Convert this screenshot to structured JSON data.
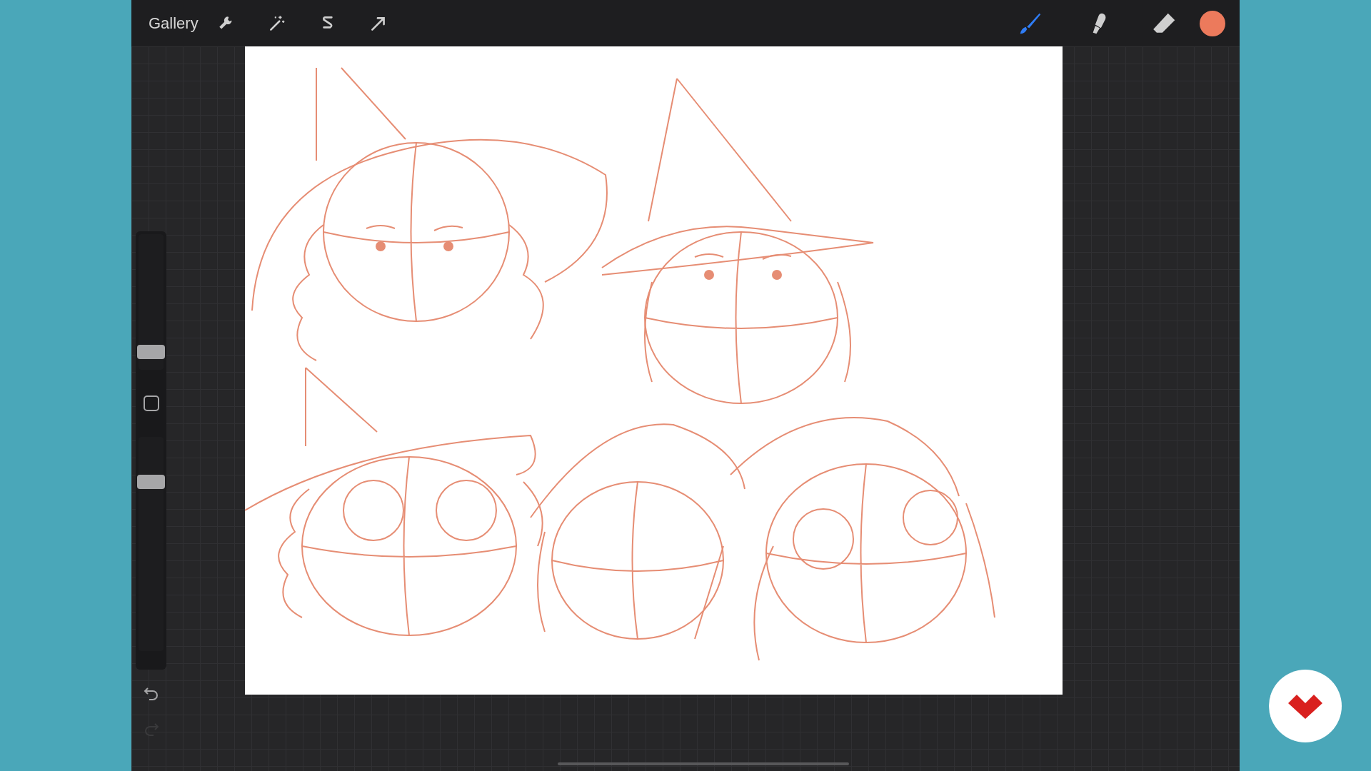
{
  "toolbar": {
    "gallery": "Gallery",
    "paint_tools": [
      {
        "selected": true
      },
      {
        "selected": false
      },
      {
        "selected": false
      }
    ],
    "color_swatch": {
      "color": "#ec7a5c"
    }
  },
  "sidebar": {
    "brush_size": {
      "level": 0.13
    },
    "brush_opacity": {
      "level": 0.79
    },
    "undo": {
      "disabled": false
    },
    "redo": {
      "disabled": true
    }
  }
}
